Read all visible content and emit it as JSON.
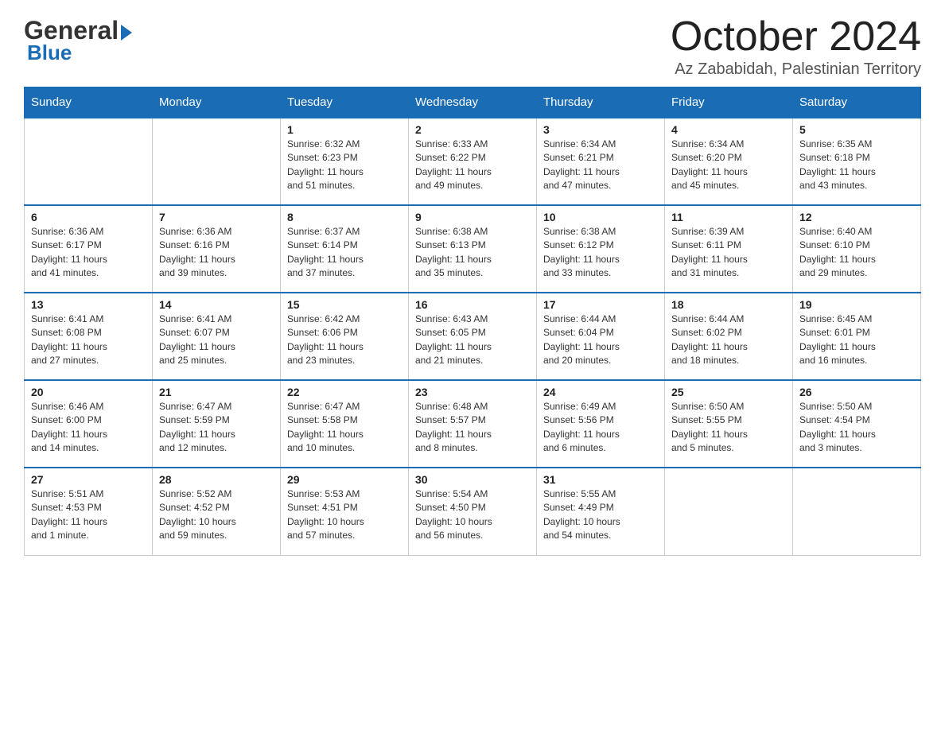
{
  "header": {
    "logo_part1": "General",
    "logo_part2": "Blue",
    "month_title": "October 2024",
    "subtitle": "Az Zababidah, Palestinian Territory"
  },
  "weekdays": [
    "Sunday",
    "Monday",
    "Tuesday",
    "Wednesday",
    "Thursday",
    "Friday",
    "Saturday"
  ],
  "weeks": [
    [
      {
        "day": "",
        "info": ""
      },
      {
        "day": "",
        "info": ""
      },
      {
        "day": "1",
        "info": "Sunrise: 6:32 AM\nSunset: 6:23 PM\nDaylight: 11 hours\nand 51 minutes."
      },
      {
        "day": "2",
        "info": "Sunrise: 6:33 AM\nSunset: 6:22 PM\nDaylight: 11 hours\nand 49 minutes."
      },
      {
        "day": "3",
        "info": "Sunrise: 6:34 AM\nSunset: 6:21 PM\nDaylight: 11 hours\nand 47 minutes."
      },
      {
        "day": "4",
        "info": "Sunrise: 6:34 AM\nSunset: 6:20 PM\nDaylight: 11 hours\nand 45 minutes."
      },
      {
        "day": "5",
        "info": "Sunrise: 6:35 AM\nSunset: 6:18 PM\nDaylight: 11 hours\nand 43 minutes."
      }
    ],
    [
      {
        "day": "6",
        "info": "Sunrise: 6:36 AM\nSunset: 6:17 PM\nDaylight: 11 hours\nand 41 minutes."
      },
      {
        "day": "7",
        "info": "Sunrise: 6:36 AM\nSunset: 6:16 PM\nDaylight: 11 hours\nand 39 minutes."
      },
      {
        "day": "8",
        "info": "Sunrise: 6:37 AM\nSunset: 6:14 PM\nDaylight: 11 hours\nand 37 minutes."
      },
      {
        "day": "9",
        "info": "Sunrise: 6:38 AM\nSunset: 6:13 PM\nDaylight: 11 hours\nand 35 minutes."
      },
      {
        "day": "10",
        "info": "Sunrise: 6:38 AM\nSunset: 6:12 PM\nDaylight: 11 hours\nand 33 minutes."
      },
      {
        "day": "11",
        "info": "Sunrise: 6:39 AM\nSunset: 6:11 PM\nDaylight: 11 hours\nand 31 minutes."
      },
      {
        "day": "12",
        "info": "Sunrise: 6:40 AM\nSunset: 6:10 PM\nDaylight: 11 hours\nand 29 minutes."
      }
    ],
    [
      {
        "day": "13",
        "info": "Sunrise: 6:41 AM\nSunset: 6:08 PM\nDaylight: 11 hours\nand 27 minutes."
      },
      {
        "day": "14",
        "info": "Sunrise: 6:41 AM\nSunset: 6:07 PM\nDaylight: 11 hours\nand 25 minutes."
      },
      {
        "day": "15",
        "info": "Sunrise: 6:42 AM\nSunset: 6:06 PM\nDaylight: 11 hours\nand 23 minutes."
      },
      {
        "day": "16",
        "info": "Sunrise: 6:43 AM\nSunset: 6:05 PM\nDaylight: 11 hours\nand 21 minutes."
      },
      {
        "day": "17",
        "info": "Sunrise: 6:44 AM\nSunset: 6:04 PM\nDaylight: 11 hours\nand 20 minutes."
      },
      {
        "day": "18",
        "info": "Sunrise: 6:44 AM\nSunset: 6:02 PM\nDaylight: 11 hours\nand 18 minutes."
      },
      {
        "day": "19",
        "info": "Sunrise: 6:45 AM\nSunset: 6:01 PM\nDaylight: 11 hours\nand 16 minutes."
      }
    ],
    [
      {
        "day": "20",
        "info": "Sunrise: 6:46 AM\nSunset: 6:00 PM\nDaylight: 11 hours\nand 14 minutes."
      },
      {
        "day": "21",
        "info": "Sunrise: 6:47 AM\nSunset: 5:59 PM\nDaylight: 11 hours\nand 12 minutes."
      },
      {
        "day": "22",
        "info": "Sunrise: 6:47 AM\nSunset: 5:58 PM\nDaylight: 11 hours\nand 10 minutes."
      },
      {
        "day": "23",
        "info": "Sunrise: 6:48 AM\nSunset: 5:57 PM\nDaylight: 11 hours\nand 8 minutes."
      },
      {
        "day": "24",
        "info": "Sunrise: 6:49 AM\nSunset: 5:56 PM\nDaylight: 11 hours\nand 6 minutes."
      },
      {
        "day": "25",
        "info": "Sunrise: 6:50 AM\nSunset: 5:55 PM\nDaylight: 11 hours\nand 5 minutes."
      },
      {
        "day": "26",
        "info": "Sunrise: 5:50 AM\nSunset: 4:54 PM\nDaylight: 11 hours\nand 3 minutes."
      }
    ],
    [
      {
        "day": "27",
        "info": "Sunrise: 5:51 AM\nSunset: 4:53 PM\nDaylight: 11 hours\nand 1 minute."
      },
      {
        "day": "28",
        "info": "Sunrise: 5:52 AM\nSunset: 4:52 PM\nDaylight: 10 hours\nand 59 minutes."
      },
      {
        "day": "29",
        "info": "Sunrise: 5:53 AM\nSunset: 4:51 PM\nDaylight: 10 hours\nand 57 minutes."
      },
      {
        "day": "30",
        "info": "Sunrise: 5:54 AM\nSunset: 4:50 PM\nDaylight: 10 hours\nand 56 minutes."
      },
      {
        "day": "31",
        "info": "Sunrise: 5:55 AM\nSunset: 4:49 PM\nDaylight: 10 hours\nand 54 minutes."
      },
      {
        "day": "",
        "info": ""
      },
      {
        "day": "",
        "info": ""
      }
    ]
  ]
}
